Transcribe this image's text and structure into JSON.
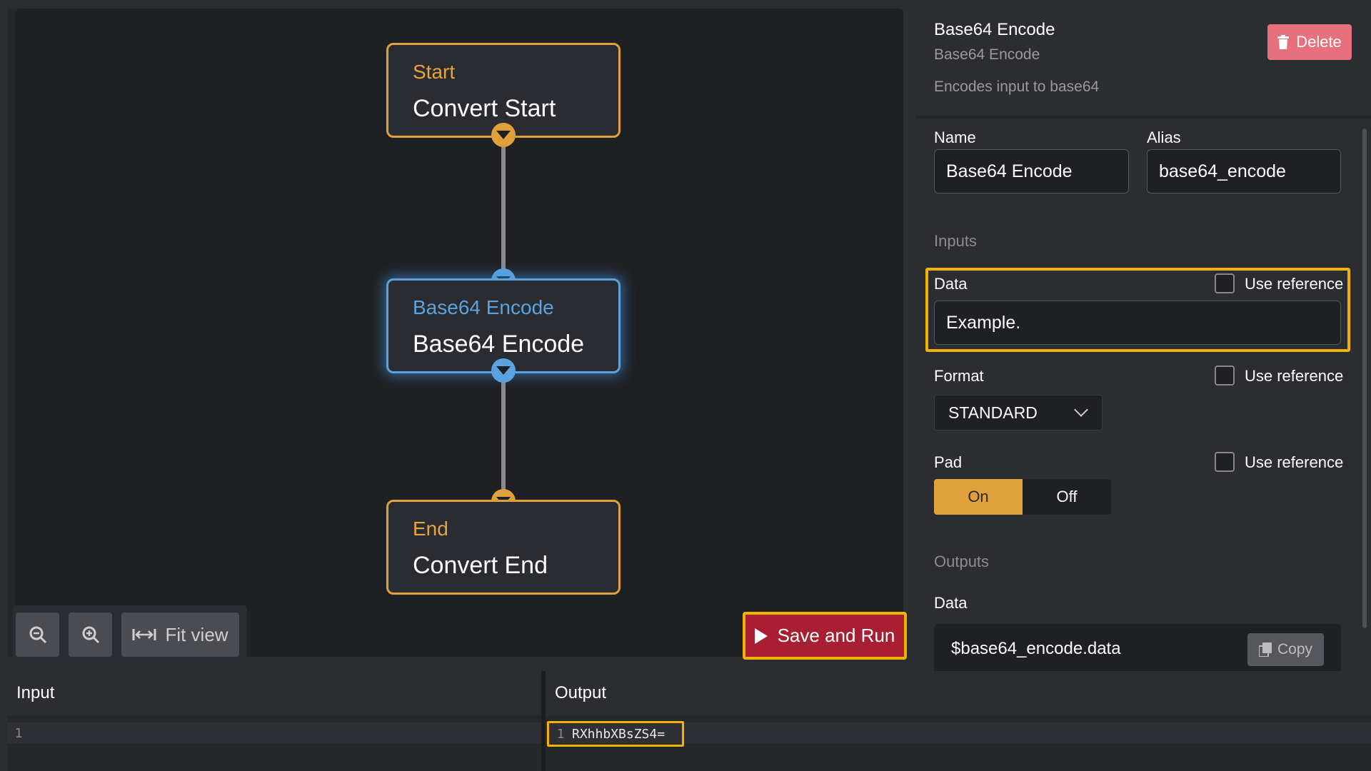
{
  "canvas": {
    "nodes": [
      {
        "type": "Start",
        "name": "Convert Start"
      },
      {
        "type": "Base64 Encode",
        "name": "Base64 Encode"
      },
      {
        "type": "End",
        "name": "Convert End"
      }
    ],
    "controls": {
      "fit_view": "Fit view"
    },
    "run_button": "Save and Run"
  },
  "panel": {
    "title": "Base64 Encode",
    "subtitle": "Base64 Encode",
    "description": "Encodes input to base64",
    "delete_label": "Delete",
    "name_label": "Name",
    "name_value": "Base64 Encode",
    "alias_label": "Alias",
    "alias_value": "base64_encode",
    "inputs_heading": "Inputs",
    "data_label": "Data",
    "data_value": "Example.",
    "use_reference": "Use reference",
    "format_label": "Format",
    "format_value": "STANDARD",
    "pad_label": "Pad",
    "pad_on": "On",
    "pad_off": "Off",
    "outputs_heading": "Outputs",
    "output_data_label": "Data",
    "output_data_value": "$base64_encode.data",
    "copy_label": "Copy"
  },
  "io": {
    "input_title": "Input",
    "output_title": "Output",
    "input_line_no": "1",
    "output_line_no": "1",
    "output_value": "RXhhbXBsZS4="
  },
  "colors": {
    "accent": "#e0a03c",
    "selected": "#5ba3e0",
    "run": "#a81e33",
    "highlight": "#f0b400"
  }
}
